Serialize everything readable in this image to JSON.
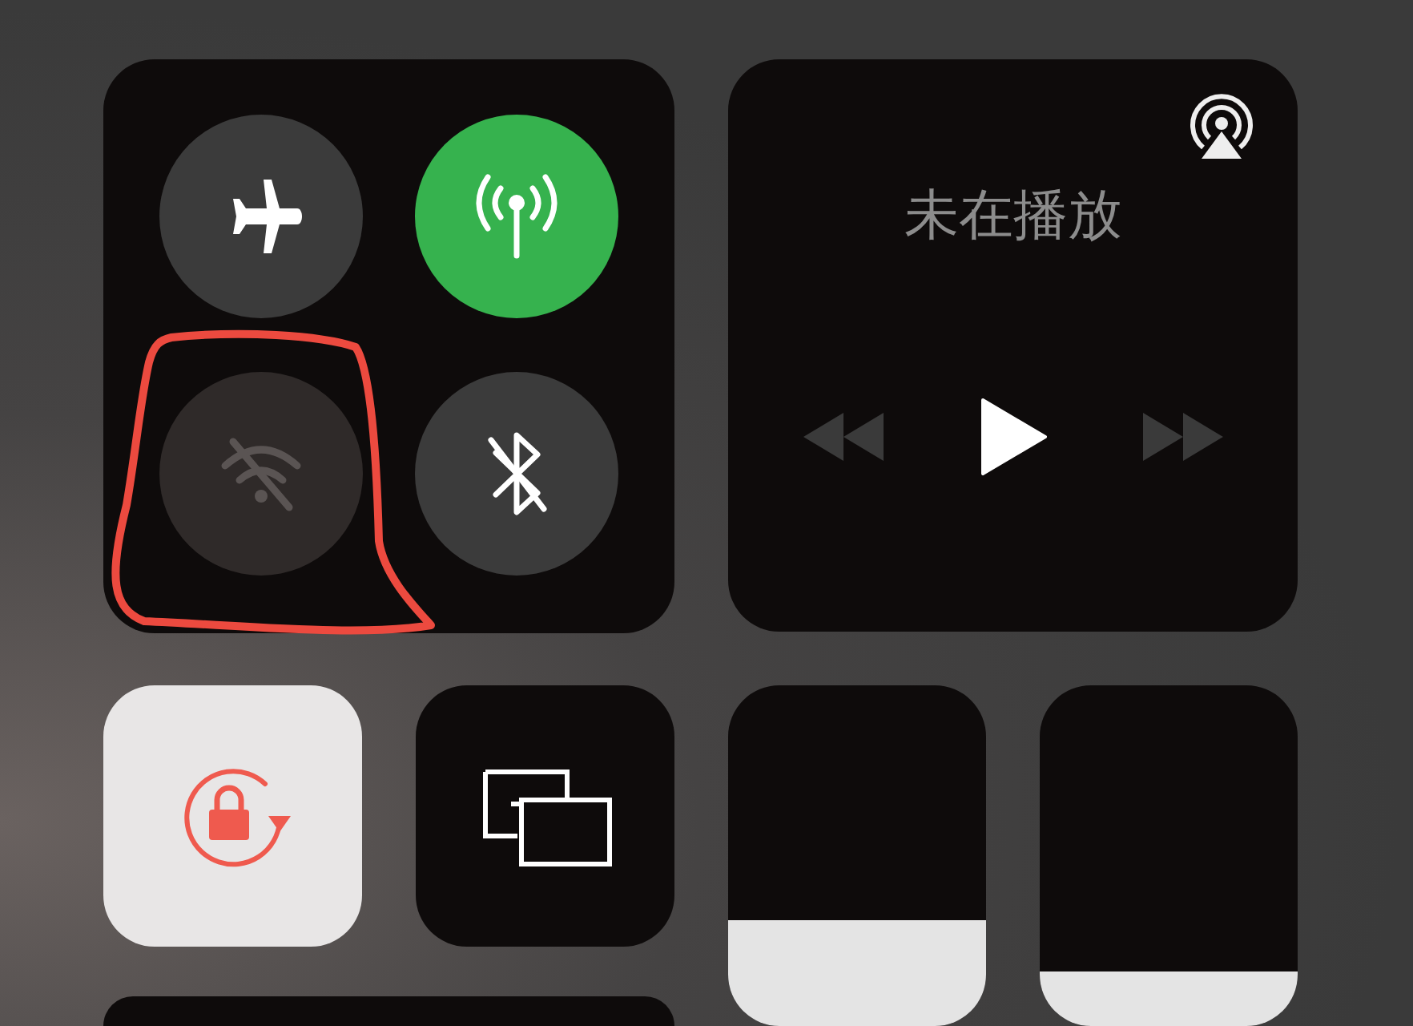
{
  "connectivity": [
    {
      "kind": "airplane",
      "on": false,
      "disabled": false
    },
    {
      "kind": "cellular",
      "on": true,
      "disabled": false
    },
    {
      "kind": "wifi",
      "on": false,
      "disabled": true
    },
    {
      "kind": "bluetooth",
      "on": false,
      "disabled": false
    }
  ],
  "media": {
    "status": "未在播放",
    "controls": [
      {
        "kind": "rewind",
        "disabled": true
      },
      {
        "kind": "play",
        "disabled": false
      },
      {
        "kind": "forward",
        "disabled": true
      }
    ]
  },
  "tiles": [
    {
      "kind": "rotation-lock",
      "on": true
    },
    {
      "kind": "screen-mirroring",
      "on": false
    }
  ],
  "sliders": [
    {
      "level": 0.31
    },
    {
      "level": 0.16
    }
  ]
}
